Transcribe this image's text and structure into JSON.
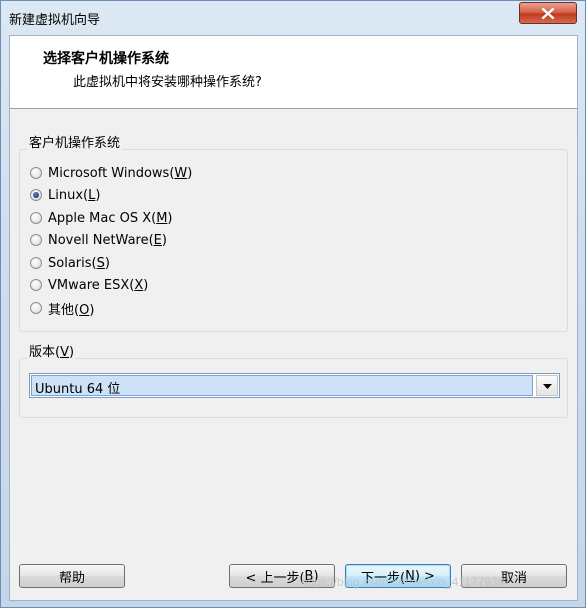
{
  "window": {
    "title": "新建虚拟机向导"
  },
  "header": {
    "title": "选择客户机操作系统",
    "subtitle": "此虚拟机中将安装哪种操作系统?"
  },
  "os_group": {
    "label": "客户机操作系统",
    "options": [
      {
        "text": "Microsoft Windows(",
        "key": "W",
        "close": ")",
        "checked": false
      },
      {
        "text": "Linux(",
        "key": "L",
        "close": ")",
        "checked": true
      },
      {
        "text": "Apple Mac OS X(",
        "key": "M",
        "close": ")",
        "checked": false
      },
      {
        "text": "Novell NetWare(",
        "key": "E",
        "close": ")",
        "checked": false
      },
      {
        "text": "Solaris(",
        "key": "S",
        "close": ")",
        "checked": false
      },
      {
        "text": "VMware ESX(",
        "key": "X",
        "close": ")",
        "checked": false
      },
      {
        "text": "其他(",
        "key": "O",
        "close": ")",
        "checked": false
      }
    ]
  },
  "version_group": {
    "label_text": "版本(",
    "label_key": "V",
    "label_close": ")",
    "selected": "Ubuntu 64 位"
  },
  "buttons": {
    "help": "帮助",
    "back_text": "< 上一步(",
    "back_key": "B",
    "back_close": ")",
    "next_text": "下一步(",
    "next_key": "N",
    "next_close": ") >",
    "cancel": "取消"
  },
  "watermark": "https://blog.csdn.net/weixin_41177939",
  "colors": {
    "selection": "#cde2f7",
    "default_button_border": "#3c7fb1",
    "close_button": "#c03a1f"
  }
}
